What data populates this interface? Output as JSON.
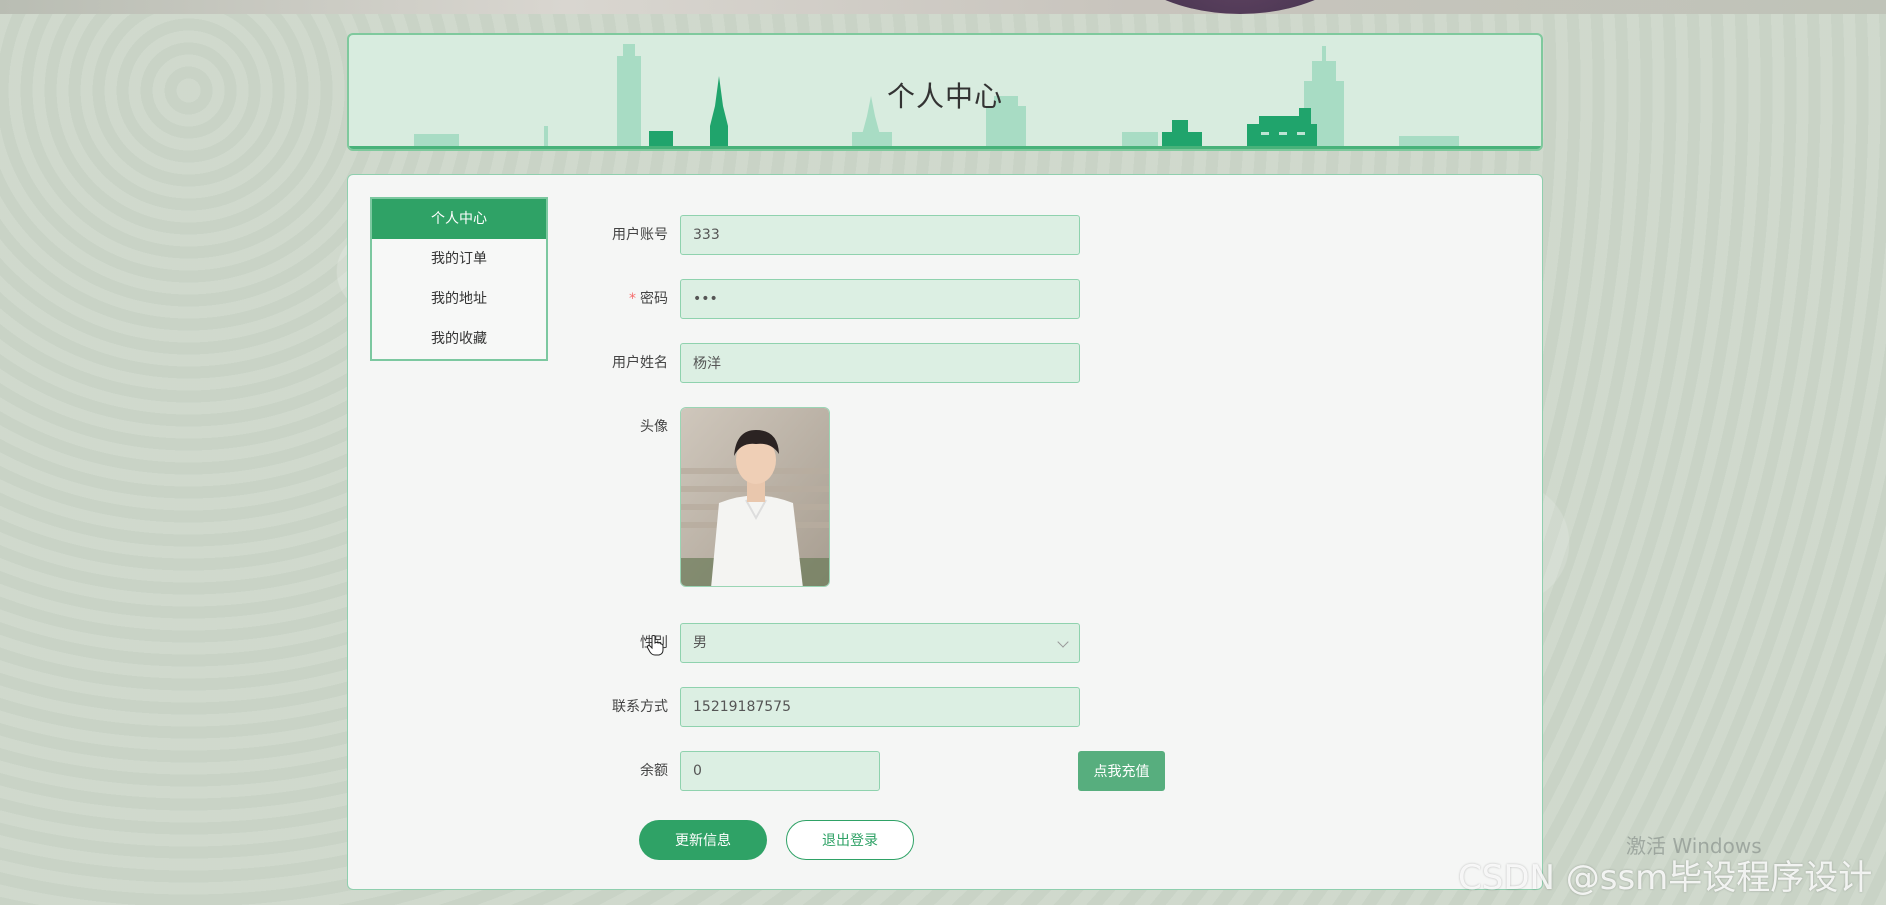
{
  "header": {
    "title": "个人中心"
  },
  "side_menu": {
    "items": [
      {
        "label": "个人中心",
        "active": true
      },
      {
        "label": "我的订单",
        "active": false
      },
      {
        "label": "我的地址",
        "active": false
      },
      {
        "label": "我的收藏",
        "active": false
      }
    ]
  },
  "form": {
    "account": {
      "label": "用户账号",
      "value": "333"
    },
    "password": {
      "required_mark": "*",
      "label": "密码",
      "value": "•••"
    },
    "name": {
      "label": "用户姓名",
      "value": "杨洋"
    },
    "avatar": {
      "label": "头像"
    },
    "gender": {
      "label": "性别",
      "value": "男"
    },
    "phone": {
      "label": "联系方式",
      "value": "15219187575"
    },
    "balance": {
      "label": "余额",
      "value": "0",
      "recharge_label": "点我充值"
    }
  },
  "actions": {
    "update_label": "更新信息",
    "logout_label": "退出登录"
  },
  "watermarks": {
    "windows": "激活 Windows",
    "csdn": "CSDN @ssm毕设程序设计"
  },
  "colors": {
    "accent": "#2fa266",
    "field_bg": "#dcefe3",
    "banner_bg": "#d8ecdf"
  }
}
